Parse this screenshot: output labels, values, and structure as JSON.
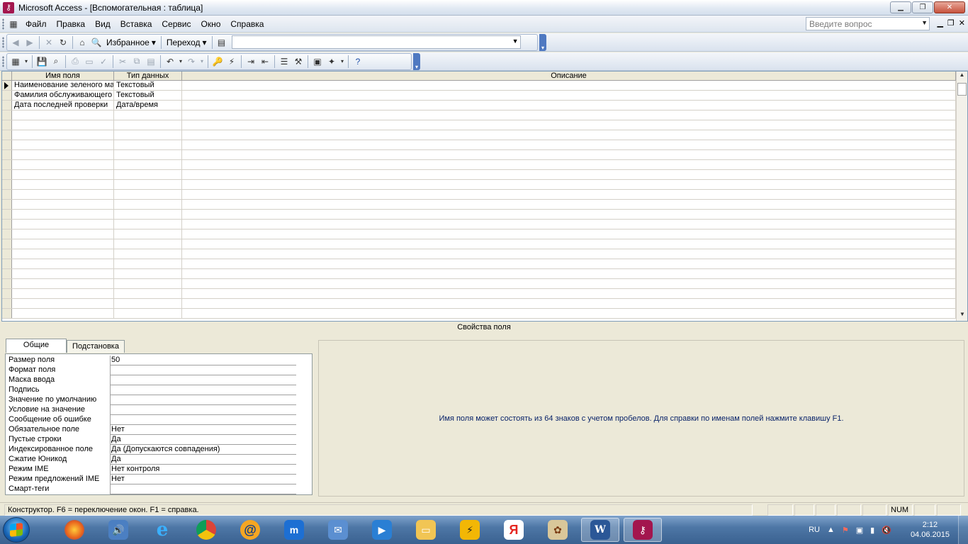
{
  "window": {
    "title": "Microsoft Access - [Вспомогательная : таблица]"
  },
  "menu": {
    "items": [
      "Файл",
      "Правка",
      "Вид",
      "Вставка",
      "Сервис",
      "Окно",
      "Справка"
    ]
  },
  "question_box": {
    "placeholder": "Введите вопрос"
  },
  "web_toolbar": {
    "favorites": "Избранное",
    "goto": "Переход"
  },
  "grid": {
    "headers": {
      "name": "Имя поля",
      "type": "Тип данных",
      "description": "Описание"
    },
    "rows": [
      {
        "name": "Наименование зеленого массива",
        "type": "Текстовый",
        "description": ""
      },
      {
        "name": "Фамилия обслуживающего",
        "type": "Текстовый",
        "description": ""
      },
      {
        "name": "Дата последней проверки",
        "type": "Дата/время",
        "description": ""
      }
    ]
  },
  "properties": {
    "title": "Свойства поля",
    "tabs": [
      "Общие",
      "Подстановка"
    ],
    "rows": [
      {
        "label": "Размер поля",
        "value": "50"
      },
      {
        "label": "Формат поля",
        "value": ""
      },
      {
        "label": "Маска ввода",
        "value": ""
      },
      {
        "label": "Подпись",
        "value": ""
      },
      {
        "label": "Значение по умолчанию",
        "value": ""
      },
      {
        "label": "Условие на значение",
        "value": ""
      },
      {
        "label": "Сообщение об ошибке",
        "value": ""
      },
      {
        "label": "Обязательное поле",
        "value": "Нет"
      },
      {
        "label": "Пустые строки",
        "value": "Да"
      },
      {
        "label": "Индексированное поле",
        "value": "Да (Допускаются совпадения)"
      },
      {
        "label": "Сжатие Юникод",
        "value": "Да"
      },
      {
        "label": "Режим IME",
        "value": "Нет контроля"
      },
      {
        "label": "Режим предложений IME",
        "value": "Нет"
      },
      {
        "label": "Смарт-теги",
        "value": ""
      }
    ],
    "help": "Имя поля может состоять из 64 знаков с учетом пробелов.  Для справки по именам полей нажмите клавишу F1."
  },
  "status": {
    "text": "Конструктор.  F6 = переключение окон.  F1 = справка.",
    "num": "NUM"
  },
  "taskbar": {
    "language": "RU",
    "time": "2:12",
    "date": "04.06.2015",
    "word_label": "W",
    "yandex_label": "Я"
  }
}
